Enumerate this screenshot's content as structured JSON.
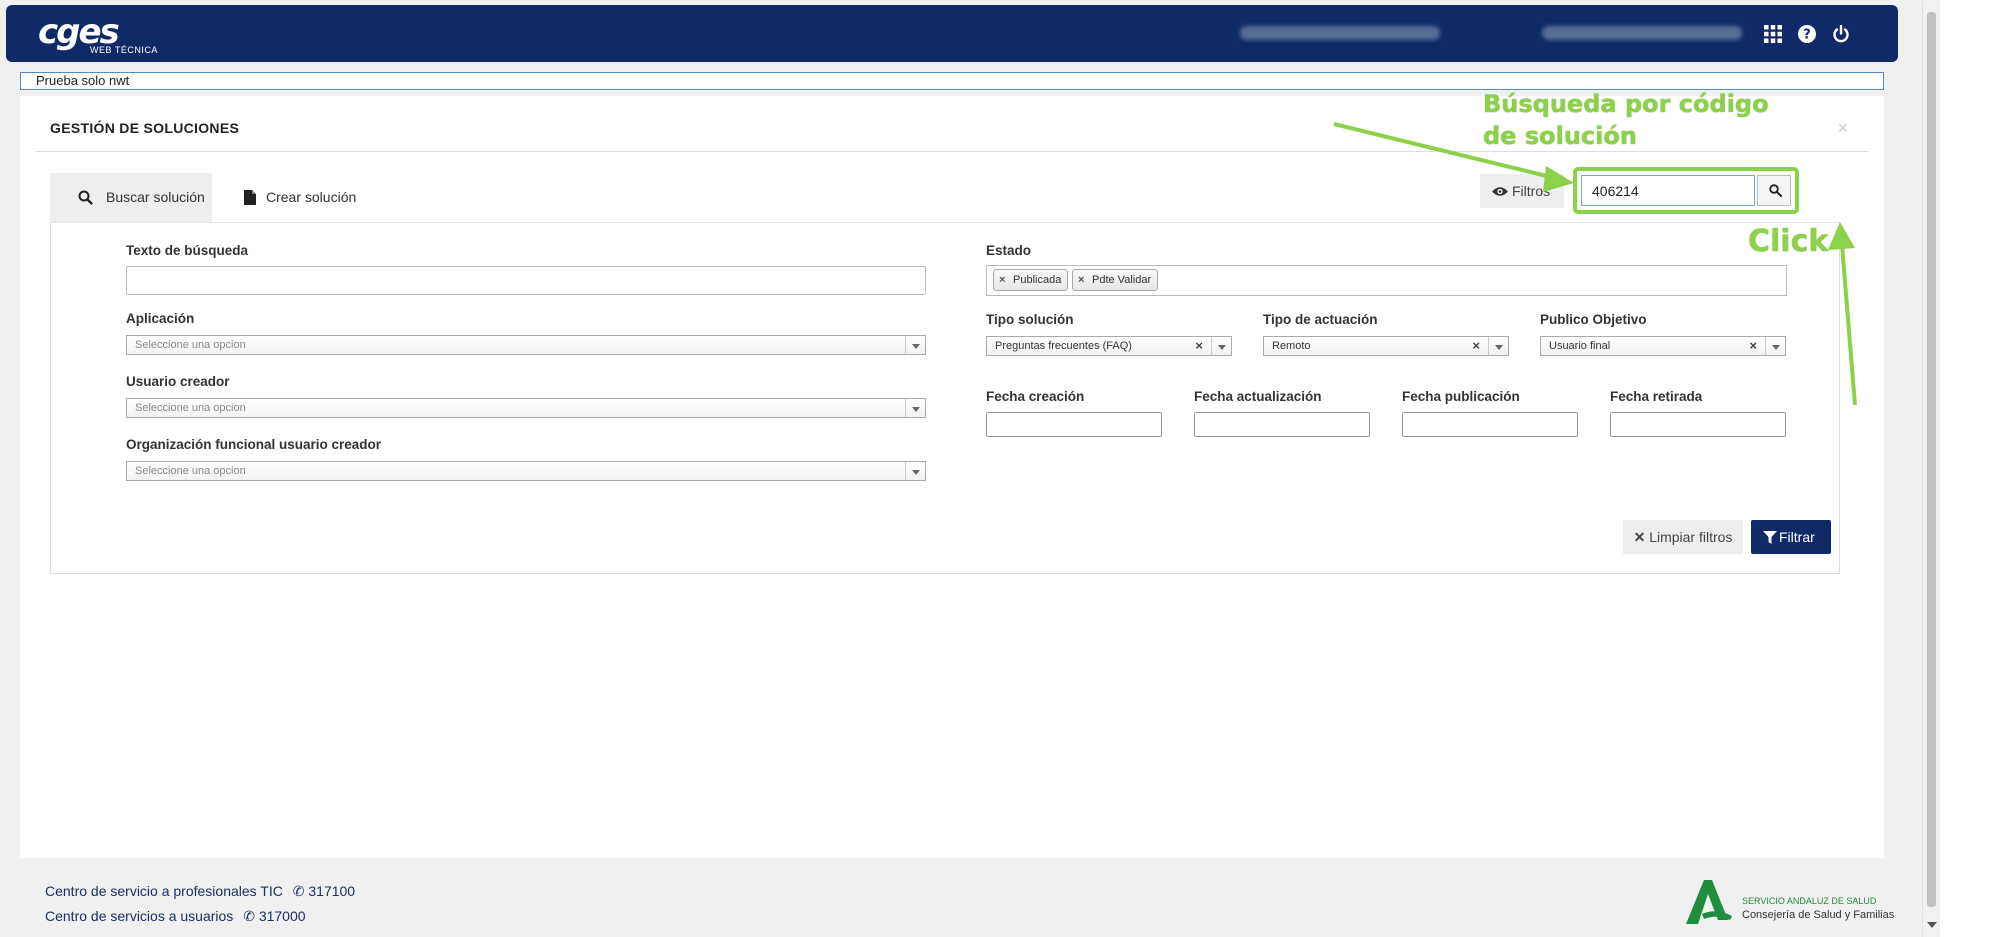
{
  "header": {
    "logo_text": "cges",
    "logo_sub": "WEB TÉCNICA",
    "icons": [
      "apps-grid-icon",
      "help-icon",
      "power-icon"
    ]
  },
  "notice": "Prueba solo nwt",
  "panel": {
    "title": "GESTIÓN DE SOLUCIONES",
    "close": "×"
  },
  "tabs": [
    {
      "label": "Buscar solución",
      "icon": "search-icon",
      "active": true
    },
    {
      "label": "Crear solución",
      "icon": "document-icon",
      "active": false
    }
  ],
  "toolbar": {
    "filters_label": "Filtros",
    "code_search_value": "406214"
  },
  "filters": {
    "search_text_label": "Texto de búsqueda",
    "search_text_value": "",
    "application_label": "Aplicación",
    "application_placeholder": "Seleccione una opcion",
    "creator_label": "Usuario creador",
    "creator_placeholder": "Seleccione una opcion",
    "org_label": "Organización funcional usuario creador",
    "org_placeholder": "Seleccione una opcion",
    "state_label": "Estado",
    "state_tags": [
      "Publicada",
      "Pdte Validar"
    ],
    "type_label": "Tipo solución",
    "type_value": "Preguntas frecuentes (FAQ)",
    "action_label": "Tipo de actuación",
    "action_value": "Remoto",
    "audience_label": "Publico Objetivo",
    "audience_value": "Usuario final",
    "date_created_label": "Fecha creación",
    "date_updated_label": "Fecha actualización",
    "date_published_label": "Fecha publicación",
    "date_retired_label": "Fecha retirada",
    "clear_label": "Limpiar filtros",
    "filter_label": "Filtrar"
  },
  "annotations": {
    "code_search_line1": "Búsqueda por código",
    "code_search_line2": "de solución",
    "click": "Click"
  },
  "footer": {
    "line1_text": "Centro de servicio a profesionales TIC",
    "line1_phone": "317100",
    "line2_text": "Centro de servicios a usuarios",
    "line2_phone": "317000",
    "org_name": "SERVICIO ANDALUZ DE SALUD",
    "org_dept": "Consejería de Salud y Familias"
  },
  "colors": {
    "brand_navy": "#0f2a66",
    "annotation_green": "#8bd14a",
    "sas_green": "#1e8e3e"
  }
}
